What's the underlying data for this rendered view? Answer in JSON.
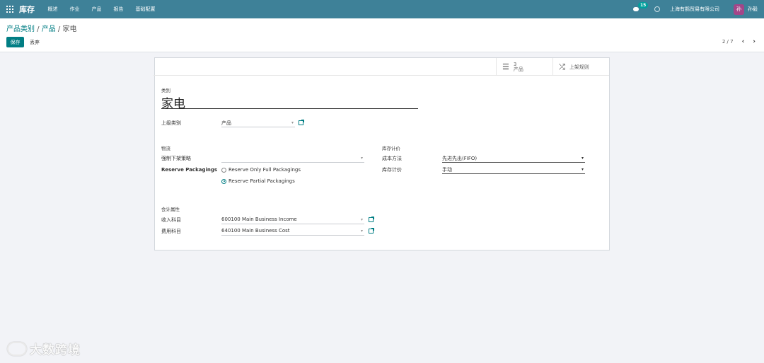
{
  "navbar": {
    "app_title": "库存",
    "menu": [
      "概述",
      "作业",
      "产品",
      "报告",
      "基础配置"
    ],
    "message_count": "15",
    "company": "上海有鹄贸易有限公司",
    "avatar_letter": "孙",
    "user_name": "孙毅"
  },
  "breadcrumb": {
    "parent": "产品类别",
    "sep1": " / ",
    "middle": "产品",
    "sep2": " / ",
    "current": "家电"
  },
  "toolbar": {
    "save_label": "保存",
    "discard_label": "丢弃"
  },
  "pager": {
    "value": "2 / 7"
  },
  "smart_buttons": {
    "products_count": "3",
    "products_label": "产品",
    "putaway_label": "上架规则"
  },
  "form": {
    "category_label": "类别",
    "name": "家电",
    "parent_label": "上级类别",
    "parent_value": "产品",
    "logistics_header": "物流",
    "removal_label": "强制下架策略",
    "removal_value": "",
    "reserve_label": "Reserve Packagings",
    "reserve_options": [
      "Reserve Only Full Packagings",
      "Reserve Partial Packagings"
    ],
    "reserve_selected": 1,
    "valuation_header": "库存计价",
    "cost_method_label": "成本方法",
    "cost_method_value": "先进先出(FIFO)",
    "valuation_label": "库存计价",
    "valuation_value": "手动",
    "accounting_header": "会计属性",
    "income_label": "收入科目",
    "income_value": "600100 Main Business Income",
    "expense_label": "费用科目",
    "expense_value": "640100 Main Business Cost"
  },
  "watermark": "大数跨境",
  "colors": {
    "navbar": "#3e8198",
    "primary": "#017e84",
    "avatar": "#a24689",
    "badge": "#00a09d"
  }
}
